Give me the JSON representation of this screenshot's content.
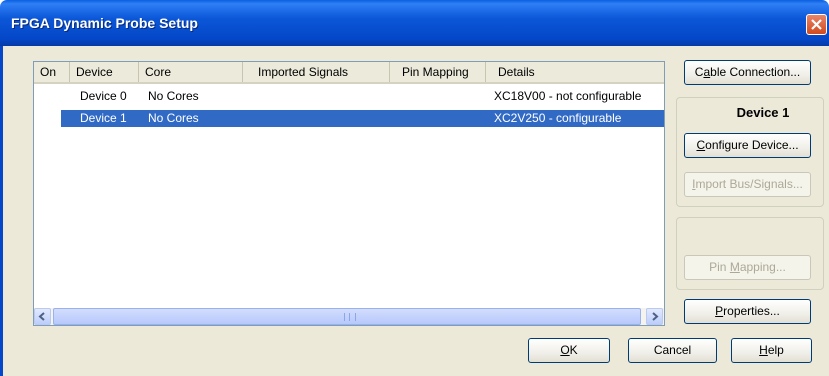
{
  "window": {
    "title": "FPGA Dynamic Probe Setup"
  },
  "table": {
    "columns": [
      "On",
      "Device",
      "Core",
      "Imported Signals",
      "Pin Mapping",
      "Details"
    ],
    "rows": [
      {
        "on": "",
        "device": "Device 0",
        "core": "No Cores",
        "imported_signals": "",
        "pin_mapping": "",
        "details": "XC18V00 - not configurable",
        "selected": false
      },
      {
        "on": "",
        "device": "Device 1",
        "core": "No Cores",
        "imported_signals": "",
        "pin_mapping": "",
        "details": "XC2V250 - configurable",
        "selected": true
      }
    ]
  },
  "right_panel": {
    "cable_connection": {
      "pre": "C",
      "u": "a",
      "post": "ble Connection..."
    },
    "device_label": "Device 1",
    "configure_device": {
      "pre": "",
      "u": "C",
      "post": "onfigure Device..."
    },
    "import_bus_signals": {
      "pre": "",
      "u": "I",
      "post": "mport Bus/Signals..."
    },
    "pin_mapping": {
      "pre": "Pin ",
      "u": "M",
      "post": "apping..."
    },
    "properties": {
      "pre": "",
      "u": "P",
      "post": "roperties..."
    }
  },
  "footer": {
    "ok": {
      "pre": "",
      "u": "O",
      "post": "K"
    },
    "cancel": "Cancel",
    "help": {
      "pre": "",
      "u": "H",
      "post": "elp"
    }
  },
  "colors": {
    "title_bar": "#0447c8",
    "selection": "#316ac5",
    "dialog_bg": "#ece9d8"
  }
}
